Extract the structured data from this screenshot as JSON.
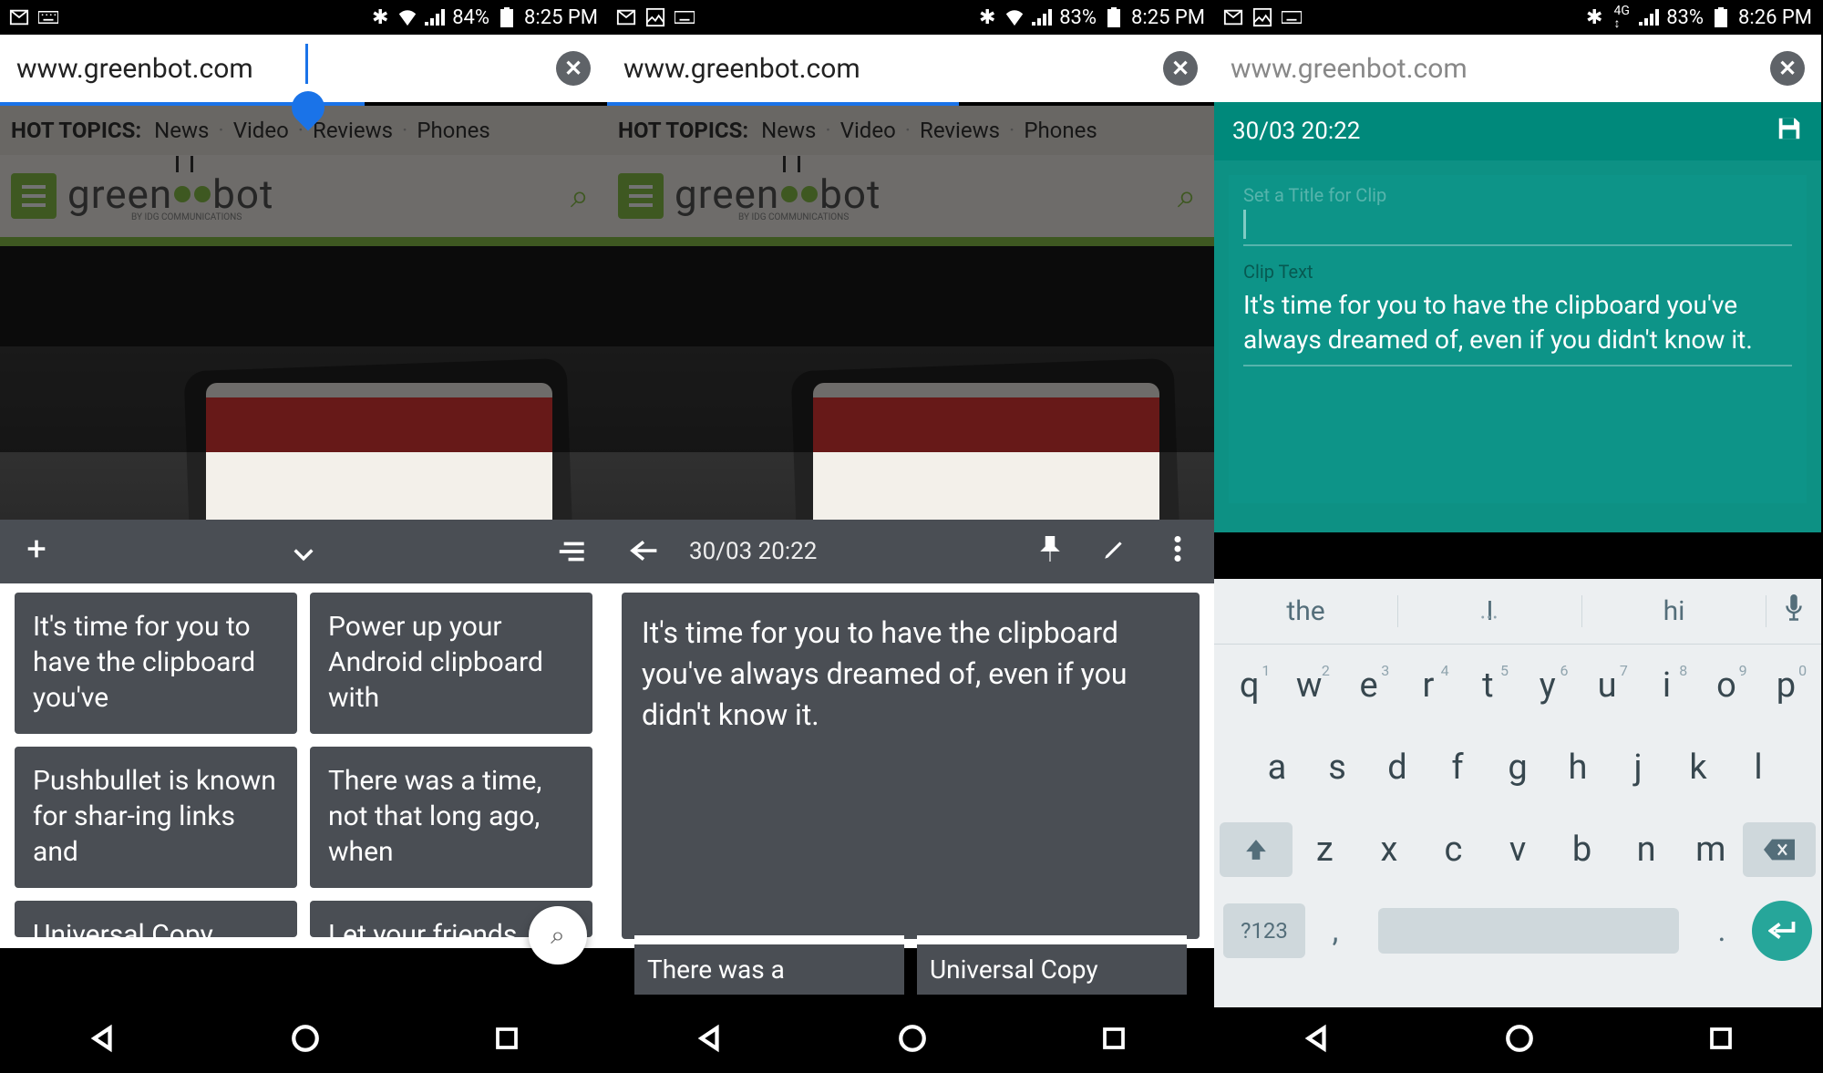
{
  "screen1": {
    "status": {
      "battery": "84%",
      "time": "8:25 PM"
    },
    "url": "www.greenbot.com",
    "hot_label": "HOT TOPICS:",
    "topics": [
      "News",
      "Video",
      "Reviews",
      "Phones"
    ],
    "logo": {
      "pre": "green",
      "post": "bot",
      "sub": "BY IDG COMMUNICATIONS"
    },
    "clips": [
      "It's time for you to have the clipboard you've",
      "Power up your Android clipboard with",
      "Pushbullet is known for shar-ing links and",
      "There was a time, not that long ago, when",
      "Universal Copy",
      "Let your friends"
    ]
  },
  "screen2": {
    "status": {
      "battery": "83%",
      "time": "8:25 PM"
    },
    "url": "www.greenbot.com",
    "hot_label": "HOT TOPICS:",
    "topics": [
      "News",
      "Video",
      "Reviews",
      "Phones"
    ],
    "toolbar_date": "30/03 20:22",
    "clip_full": "It's time for you to have the clipboard you've always dreamed of, even if you didn't know it.",
    "next1": "There was a",
    "next2": "Universal Copy"
  },
  "screen3": {
    "status": {
      "battery": "83%",
      "time": "8:26 PM"
    },
    "url": "www.greenbot.com",
    "panel_date": "30/03 20:22",
    "title_placeholder": "Set a Title for Clip",
    "clip_label": "Clip Text",
    "clip_text": "It's time for you to have the clipboard you've always dreamed of, even if you didn't know it.",
    "suggestions": [
      "the",
      "I",
      "hi"
    ],
    "row1": [
      {
        "k": "q",
        "n": "1"
      },
      {
        "k": "w",
        "n": "2"
      },
      {
        "k": "e",
        "n": "3"
      },
      {
        "k": "r",
        "n": "4"
      },
      {
        "k": "t",
        "n": "5"
      },
      {
        "k": "y",
        "n": "6"
      },
      {
        "k": "u",
        "n": "7"
      },
      {
        "k": "i",
        "n": "8"
      },
      {
        "k": "o",
        "n": "9"
      },
      {
        "k": "p",
        "n": "0"
      }
    ],
    "row2": [
      "a",
      "s",
      "d",
      "f",
      "g",
      "h",
      "j",
      "k",
      "l"
    ],
    "row3": [
      "z",
      "x",
      "c",
      "v",
      "b",
      "n",
      "m"
    ],
    "sym": "?123",
    "comma": ",",
    "period": "."
  }
}
